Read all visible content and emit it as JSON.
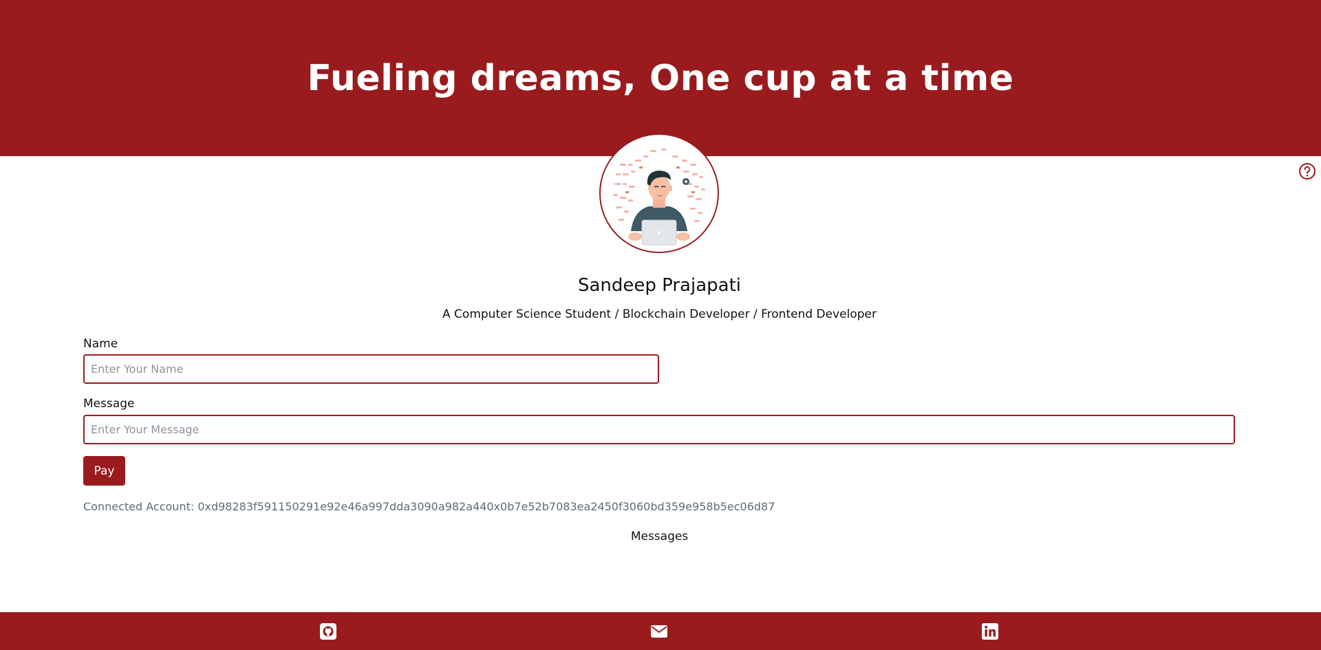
{
  "header": {
    "title": "Fueling dreams, One cup at a time"
  },
  "profile": {
    "name": "Sandeep Prajapati",
    "bio": "A Computer Science Student / Blockchain Developer / Frontend Developer"
  },
  "form": {
    "name_label": "Name",
    "name_placeholder": "Enter Your Name",
    "message_label": "Message",
    "message_placeholder": "Enter Your Message",
    "pay_label": "Pay"
  },
  "account": {
    "text": "Connected Account: 0xd98283f591150291e92e46a997dda3090a982a440x0b7e52b7083ea2450f3060bd359e958b5ec06d87"
  },
  "messages": {
    "heading": "Messages"
  },
  "footer": {
    "icons": [
      "github-icon",
      "mail-icon",
      "linkedin-icon"
    ]
  },
  "colors": {
    "brand": "#991b1e",
    "muted_text": "#5f6b7a",
    "placeholder": "#8d949c"
  }
}
